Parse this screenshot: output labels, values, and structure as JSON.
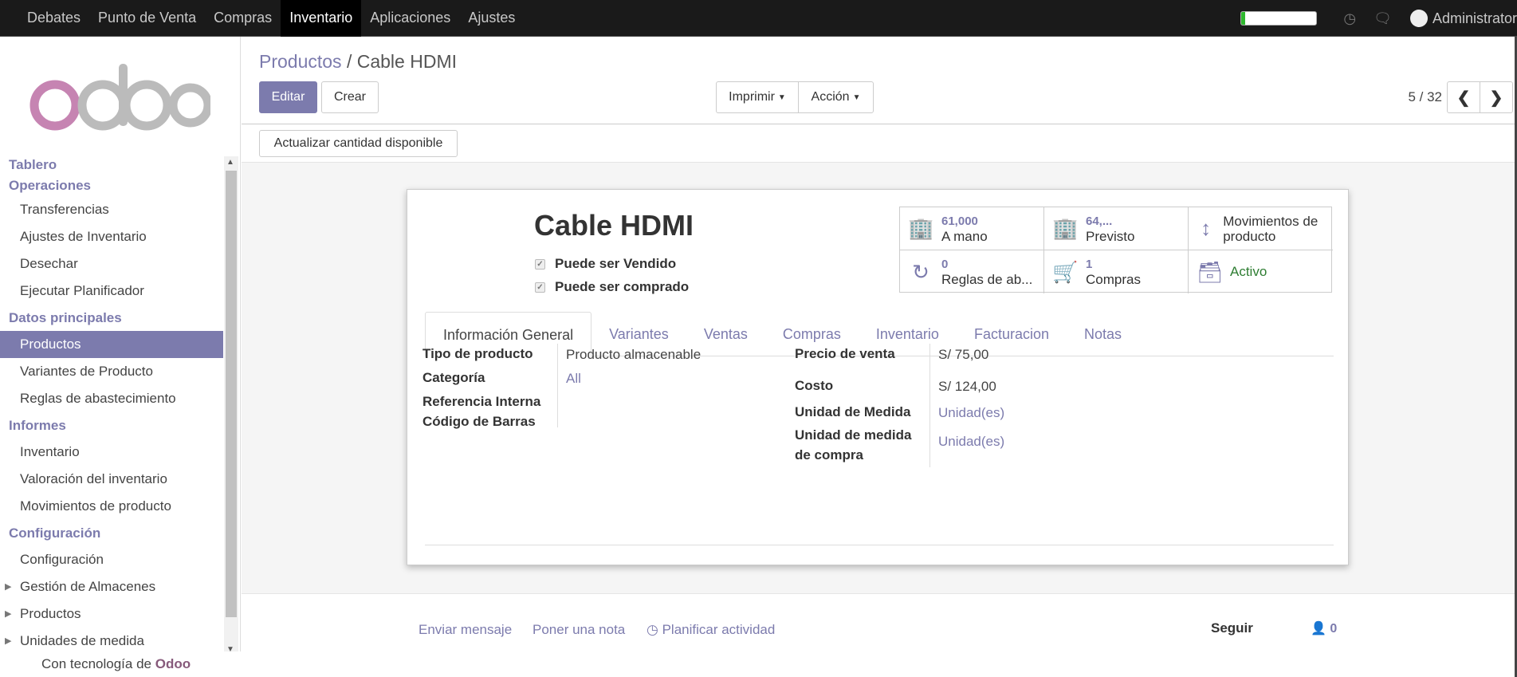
{
  "topbar": {
    "menu": [
      "Debates",
      "Punto de Venta",
      "Compras",
      "Inventario",
      "Aplicaciones",
      "Ajustes"
    ],
    "active": "Inventario",
    "user": "Administrator",
    "progress": 0.05
  },
  "sidebar": {
    "sections": [
      {
        "title": "Tablero",
        "items": []
      },
      {
        "title": "Operaciones",
        "items": [
          "Transferencias",
          "Ajustes de Inventario",
          "Desechar",
          "Ejecutar Planificador"
        ]
      },
      {
        "title": "Datos principales",
        "items": [
          "Productos",
          "Variantes de Producto",
          "Reglas de abastecimiento"
        ]
      },
      {
        "title": "Informes",
        "items": [
          "Inventario",
          "Valoración del inventario",
          "Movimientos de producto"
        ]
      },
      {
        "title": "Configuración",
        "items": [
          "Configuración",
          "Gestión de Almacenes",
          "Productos",
          "Unidades de medida"
        ]
      }
    ],
    "powered_prefix": "Con tecnología de",
    "powered_brand": "Odoo"
  },
  "breadcrumb": {
    "parent": "Productos",
    "sep": "/",
    "current": "Cable HDMI"
  },
  "buttons": {
    "edit": "Editar",
    "create": "Crear",
    "print": "Imprimir",
    "action": "Acción",
    "update_qty": "Actualizar cantidad disponible"
  },
  "pager": {
    "value": "5 / 32"
  },
  "product": {
    "name": "Cable HDMI",
    "can_be_sold": "Puede ser Vendido",
    "can_be_purchased": "Puede ser comprado"
  },
  "smart_buttons": {
    "on_hand": {
      "num": "61,000",
      "label": "A mano"
    },
    "forecast": {
      "num": "64,...",
      "label": "Previsto"
    },
    "moves": {
      "label": "Movimientos de producto"
    },
    "rules": {
      "num": "0",
      "label": "Reglas de ab..."
    },
    "purchases": {
      "num": "1",
      "label": "Compras"
    },
    "active": {
      "label": "Activo"
    }
  },
  "tabs": [
    "Información General",
    "Variantes",
    "Ventas",
    "Compras",
    "Inventario",
    "Facturacion",
    "Notas"
  ],
  "fields": {
    "type_label": "Tipo de producto",
    "type_value": "Producto almacenable",
    "category_label": "Categoría",
    "category_value": "All",
    "ref_label": "Referencia Interna",
    "barcode_label": "Código de Barras",
    "price_label": "Precio de venta",
    "price_value": "S/ 75,00",
    "cost_label": "Costo",
    "cost_value": "S/ 124,00",
    "uom_label": "Unidad de Medida",
    "uom_value": "Unidad(es)",
    "uom_po_label": "Unidad de medida de compra",
    "uom_po_value": "Unidad(es)"
  },
  "chatter": {
    "send": "Enviar mensaje",
    "note": "Poner una nota",
    "schedule": "Planificar actividad",
    "follow": "Seguir",
    "followers": "0"
  },
  "colors": {
    "accent": "#7c7bad",
    "topbar": "#1a1a1a",
    "brand": "#875a7b"
  }
}
